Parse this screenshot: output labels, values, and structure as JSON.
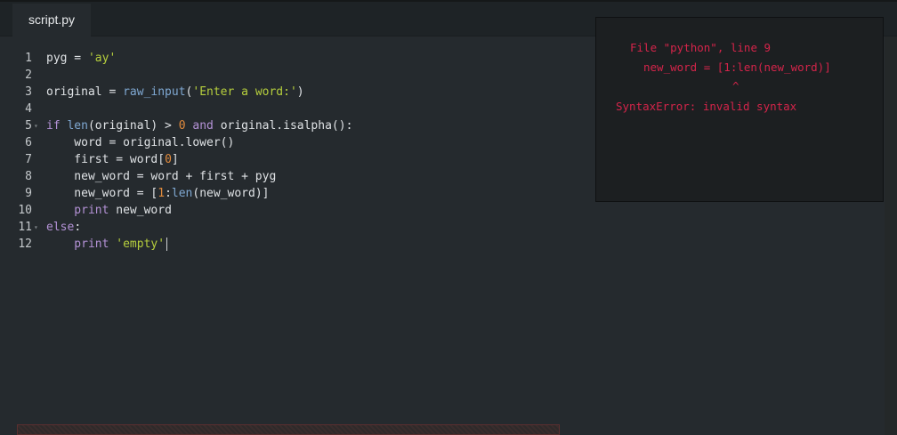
{
  "tab": {
    "label": "script.py"
  },
  "code_lines": [
    {
      "num": "1",
      "tokens": [
        [
          "",
          "pyg = "
        ],
        [
          "str",
          "'ay'"
        ]
      ]
    },
    {
      "num": "2",
      "tokens": []
    },
    {
      "num": "3",
      "tokens": [
        [
          "",
          "original = "
        ],
        [
          "bi",
          "raw_input"
        ],
        [
          "",
          "("
        ],
        [
          "str",
          "'Enter a word:'"
        ],
        [
          "",
          ")"
        ]
      ]
    },
    {
      "num": "4",
      "tokens": []
    },
    {
      "num": "5",
      "fold": true,
      "tokens": [
        [
          "kw",
          "if "
        ],
        [
          "bi",
          "len"
        ],
        [
          "",
          "(original) > "
        ],
        [
          "num",
          "0"
        ],
        [
          "kw",
          " and "
        ],
        [
          "",
          "original.isalpha():"
        ]
      ]
    },
    {
      "num": "6",
      "tokens": [
        [
          "",
          "    word = original.lower()"
        ]
      ]
    },
    {
      "num": "7",
      "tokens": [
        [
          "",
          "    first = word["
        ],
        [
          "num",
          "0"
        ],
        [
          "",
          "]"
        ]
      ]
    },
    {
      "num": "8",
      "tokens": [
        [
          "",
          "    new_word = word + first + pyg"
        ]
      ]
    },
    {
      "num": "9",
      "tokens": [
        [
          "",
          "    new_word = ["
        ],
        [
          "num",
          "1"
        ],
        [
          "",
          ":"
        ],
        [
          "bi",
          "len"
        ],
        [
          "",
          "(new_word)]"
        ]
      ]
    },
    {
      "num": "10",
      "tokens": [
        [
          "kw",
          "    print"
        ],
        [
          "",
          " new_word"
        ]
      ]
    },
    {
      "num": "11",
      "fold": true,
      "tokens": [
        [
          "kw",
          "else"
        ],
        [
          "",
          ":"
        ]
      ]
    },
    {
      "num": "12",
      "cursor": true,
      "tokens": [
        [
          "kw",
          "    print"
        ],
        [
          "",
          " "
        ],
        [
          "str",
          "'empty'"
        ]
      ]
    }
  ],
  "output": {
    "line1": "File \"python\", line 9",
    "line2": "new_word = [1:len(new_word)]",
    "line3": "^",
    "line4": "SyntaxError: invalid syntax"
  },
  "colors": {
    "background": "#252a2e",
    "keyword": "#b492d6",
    "builtin": "#7fa8d2",
    "string": "#b6cf3d",
    "number": "#e08a3c",
    "error": "#d4244a"
  },
  "icons": {
    "fold": "fold-arrow-icon"
  }
}
